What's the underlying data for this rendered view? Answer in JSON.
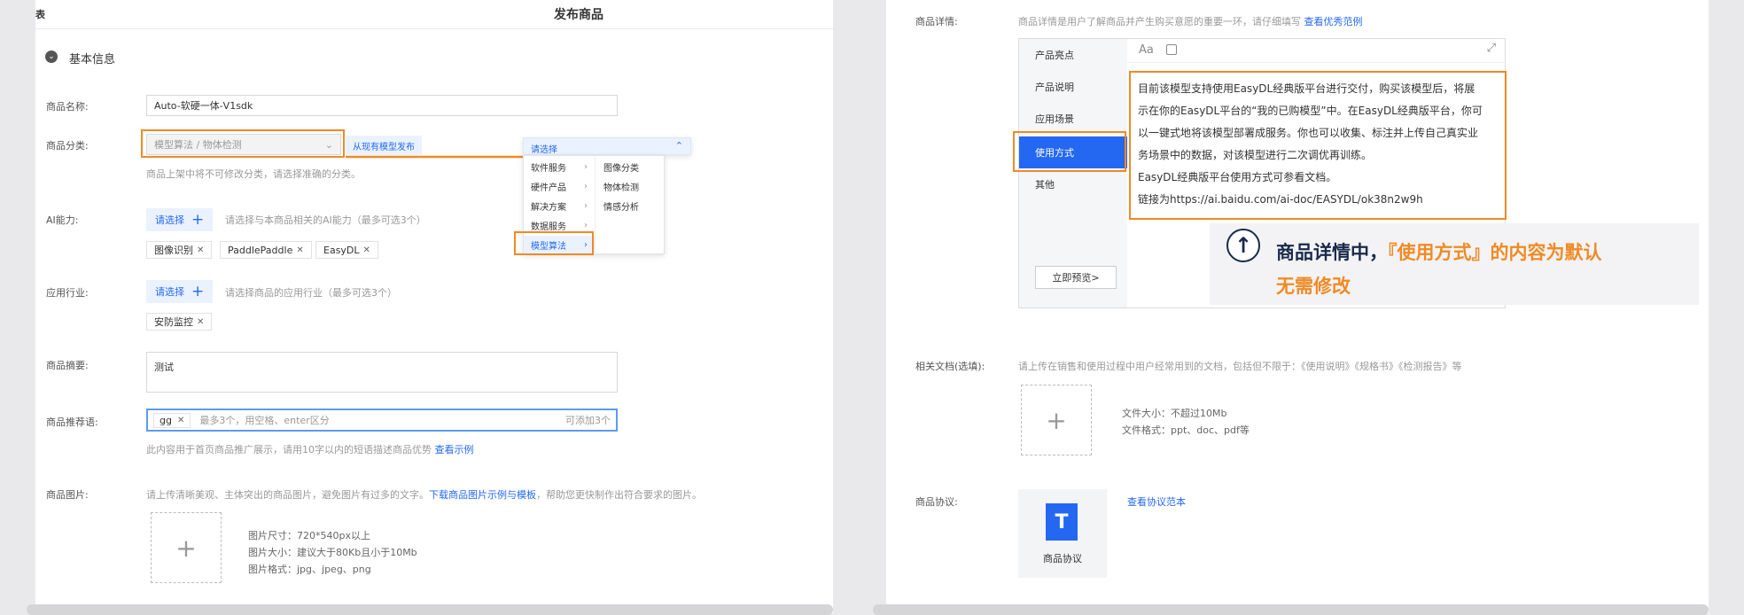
{
  "left": {
    "corner_char": "表",
    "page_title": "发布商品",
    "section_title": "基本信息",
    "product_name": {
      "label": "商品名称:",
      "value": "Auto-软硬一体-V1sdk"
    },
    "category": {
      "label": "商品分类:",
      "placeholder": "模型算法 / 物体检测",
      "from_model": "从现有模型发布",
      "hint": "商品上架中将不可修改分类，请选择准确的分类。"
    },
    "dropdown": {
      "header": "请选择",
      "level1": [
        "软件服务",
        "硬件产品",
        "解决方案",
        "数据服务",
        "模型算法"
      ],
      "level2": [
        "图像分类",
        "物体检测",
        "情感分析"
      ]
    },
    "ai_ability": {
      "label": "AI能力:",
      "button": "请选择",
      "hint": "请选择与本商品相关的AI能力（最多可选3个）",
      "tags": [
        "图像识别",
        "PaddlePaddle",
        "EasyDL"
      ]
    },
    "industry": {
      "label": "应用行业:",
      "button": "请选择",
      "hint": "请选择商品的应用行业（最多可选3个）",
      "tags": [
        "安防监控"
      ]
    },
    "summary": {
      "label": "商品摘要:",
      "value": "测试"
    },
    "recommend": {
      "label": "商品推荐语:",
      "tag": "gg",
      "placeholder": "最多3个，用空格、enter区分",
      "counter": "可添加3个",
      "hint": "此内容用于首页商品推广展示，请用10字以内的短语描述商品优势",
      "hint_link": "查看示例"
    },
    "images": {
      "label": "商品图片:",
      "hint_a": "请上传清晰美观、主体突出的商品图片，避免图片有过多的文字。",
      "hint_link": "下载商品图片示例与模板",
      "hint_b": "，帮助您更快制作出符合要求的图片。",
      "spec_size": "图片尺寸：720*540px以上",
      "spec_weight": "图片大小：建议大于80Kb且小于10Mb",
      "spec_format": "图片格式：jpg、jpeg、png"
    }
  },
  "right": {
    "detail": {
      "label": "商品详情:",
      "hint": "商品详情是用户了解商品并产生购买意愿的重要一环，请仔细填写",
      "hint_link": "查看优秀范例",
      "tabs": [
        "产品亮点",
        "产品说明",
        "应用场景",
        "使用方式",
        "其他"
      ],
      "active_tab": 3,
      "toolbar_font": "Aa",
      "content_lines": [
        "目前该模型支持使用EasyDL经典版平台进行交付，购买该模型后，将展",
        "示在你的EasyDL平台的“我的已购模型”中。在EasyDL经典版平台，你可",
        "以一键式地将该模型部署成服务。你也可以收集、标注并上传自己真实业",
        "务场景中的数据，对该模型进行二次调优再训练。",
        "EasyDL经典版平台使用方式可参看文档。",
        "链接为https://ai.baidu.com/ai-doc/EASYDL/ok38n2w9h"
      ],
      "preview_button": "立即预览>"
    },
    "callout": {
      "prefix": "商品详情中，",
      "highlight": "『使用方式』的内容为默认",
      "line2": "无需修改"
    },
    "docs": {
      "label": "相关文档(选填):",
      "hint": "请上传在销售和使用过程中用户经常用到的文档，包括但不限于：《使用说明》《规格书》《检测报告》等",
      "size": "文件大小：不超过10Mb",
      "format": "文件格式：ppt、doc、pdf等"
    },
    "agreement": {
      "label": "商品协议:",
      "link": "查看协议范本",
      "file_name": "商品协议",
      "file_letter": "T"
    }
  },
  "colors": {
    "accent": "#2468f2",
    "highlight": "#f08a24",
    "callout_text": "#1a2a4a"
  }
}
